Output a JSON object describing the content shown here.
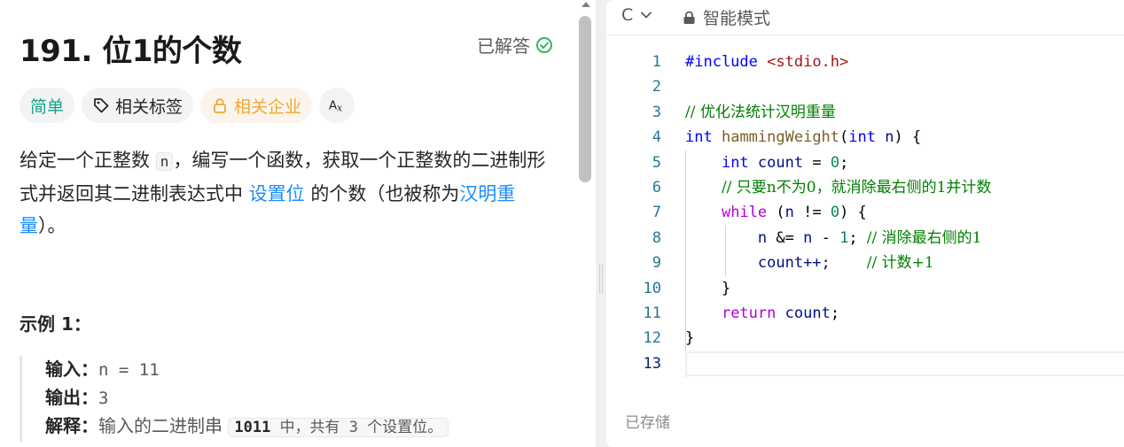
{
  "problem": {
    "title": "191. 位1的个数",
    "status": "已解答",
    "tags": {
      "difficulty": "简单",
      "topics": "相关标签",
      "companies": "相关企业"
    },
    "description": {
      "part1": "给定一个正整数 ",
      "code_n": "n",
      "part2": "，编写一个函数，获取一个正整数的二进制形式并返回其二进制表达式中 ",
      "link1": "设置位",
      "part3": " 的个数（也被称为",
      "link2": "汉明重量",
      "part4": "）。"
    },
    "example": {
      "heading": "示例 1：",
      "input_label": "输入：",
      "input_value": "n = 11",
      "output_label": "输出：",
      "output_value": "3",
      "explain_label": "解释：",
      "explain_text": "输入的二进制串",
      "explain_code_bold": "1011",
      "explain_code_rest": "中，共有 3 个设置位。"
    }
  },
  "editor": {
    "language": "C",
    "mode": "智能模式",
    "saved_status": "已存储",
    "line_numbers": [
      "1",
      "2",
      "3",
      "4",
      "5",
      "6",
      "7",
      "8",
      "9",
      "10",
      "11",
      "12",
      "13"
    ],
    "active_line": "13",
    "code": {
      "l1_pp": "#include",
      "l1_hdr": "<stdio.h>",
      "l3_comment": "// 优化法统计汉明重量",
      "l4_type": "int",
      "l4_fn": "hammingWeight",
      "l4_ptype": "int",
      "l4_param": "n",
      "l5_type": "int",
      "l5_var": "count",
      "l5_num": "0",
      "l6_comment": "// 只要n不为0，就消除最右侧的1并计数",
      "l7_kw": "while",
      "l7_num": "0",
      "l8_num": "1",
      "l8_comment": "// 消除最右侧的1",
      "l9_stmt": "count++;",
      "l9_comment": "// 计数+1",
      "l11_kw": "return",
      "l11_var": "count"
    }
  },
  "colors": {
    "easy": "#14a58d",
    "company": "#f0a833",
    "link": "#1a8cff",
    "solved_check": "#2db55d"
  },
  "icons": [
    "check-circle-icon",
    "tag-icon",
    "lock-icon",
    "translate-icon",
    "chevron-down-icon",
    "lock-icon"
  ]
}
